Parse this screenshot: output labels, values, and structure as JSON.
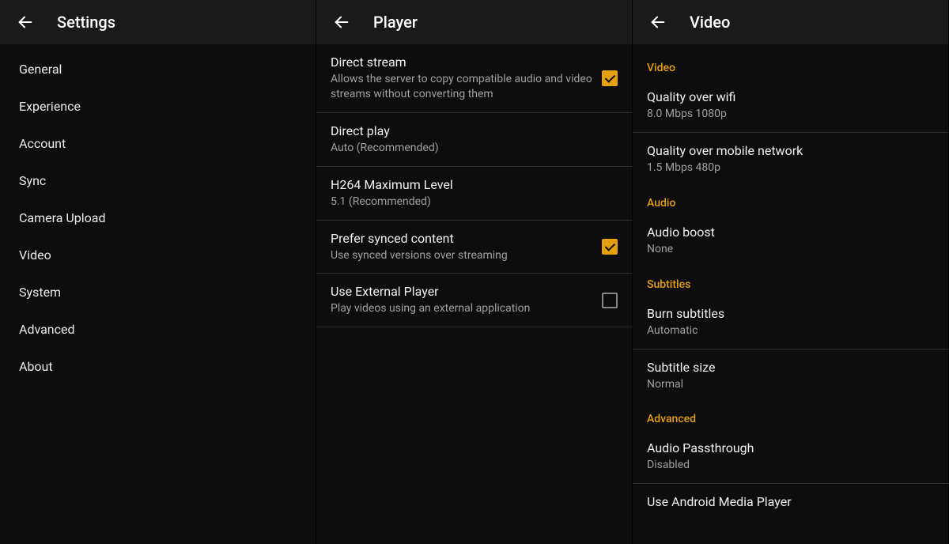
{
  "accent": "#e5a00d",
  "settings": {
    "title": "Settings",
    "items": [
      "General",
      "Experience",
      "Account",
      "Sync",
      "Camera Upload",
      "Video",
      "System",
      "Advanced",
      "About"
    ]
  },
  "player": {
    "title": "Player",
    "rows": [
      {
        "title": "Direct stream",
        "sub": "Allows the server to copy compatible audio and video streams without converting them",
        "checked": true
      },
      {
        "title": "Direct play",
        "sub": "Auto (Recommended)"
      },
      {
        "title": "H264 Maximum Level",
        "sub": "5.1 (Recommended)"
      },
      {
        "title": "Prefer synced content",
        "sub": "Use synced versions over streaming",
        "checked": true
      },
      {
        "title": "Use External Player",
        "sub": "Play videos using an external application",
        "checked": false
      }
    ]
  },
  "video": {
    "title": "Video",
    "sections": {
      "video": {
        "header": "Video",
        "wifi": {
          "title": "Quality over wifi",
          "sub": "8.0 Mbps 1080p"
        },
        "mobile": {
          "title": "Quality over mobile network",
          "sub": "1.5 Mbps 480p"
        }
      },
      "audio": {
        "header": "Audio",
        "boost": {
          "title": "Audio boost",
          "sub": "None"
        }
      },
      "subtitles": {
        "header": "Subtitles",
        "burn": {
          "title": "Burn subtitles",
          "sub": "Automatic"
        },
        "size": {
          "title": "Subtitle size",
          "sub": "Normal"
        }
      },
      "advanced": {
        "header": "Advanced",
        "passthrough": {
          "title": "Audio Passthrough",
          "sub": "Disabled"
        },
        "android": {
          "title": "Use Android Media Player"
        }
      }
    }
  }
}
